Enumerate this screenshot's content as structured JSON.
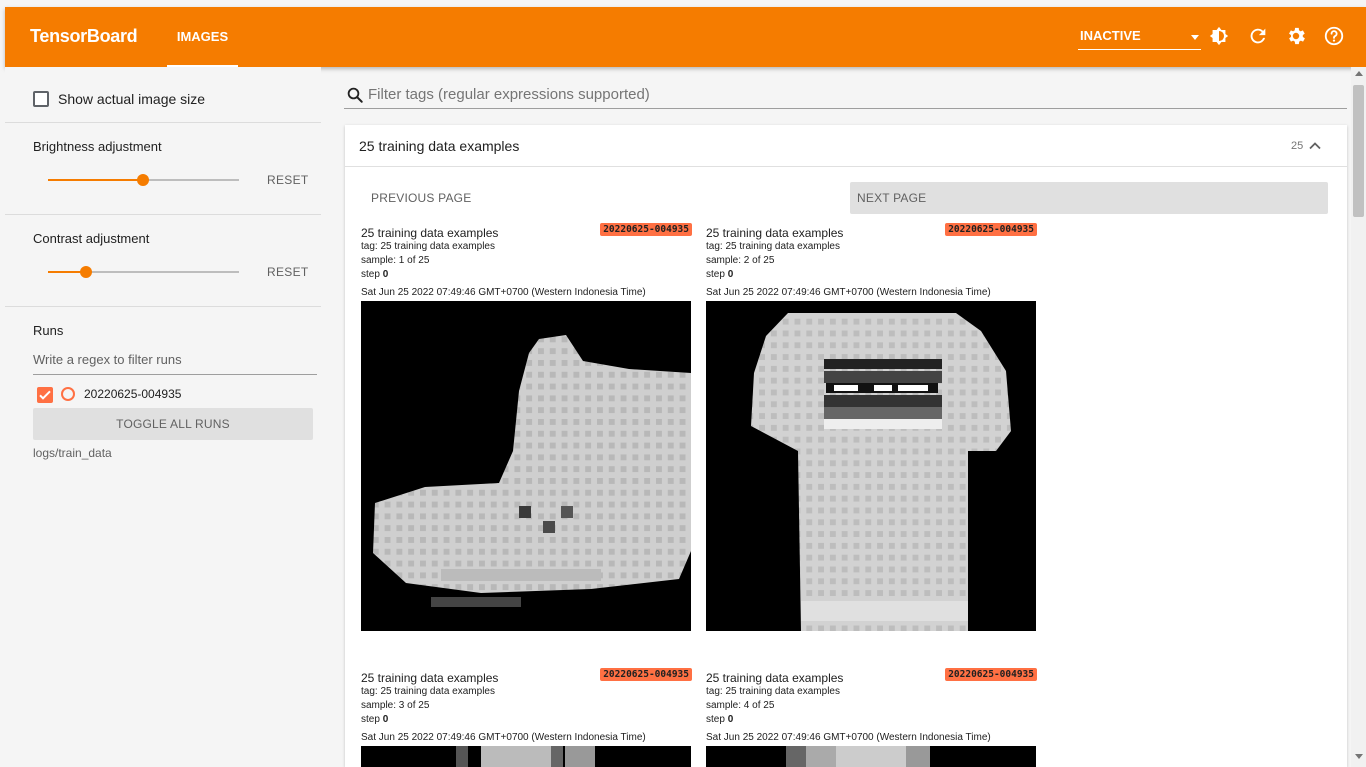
{
  "header": {
    "brand": "TensorBoard",
    "tab_images": "IMAGES",
    "inactive_label": "INACTIVE",
    "accent_color": "#f57c00",
    "icons": [
      "brightness-icon",
      "refresh-icon",
      "settings-icon",
      "help-icon"
    ]
  },
  "sidebar": {
    "show_actual_size_label": "Show actual image size",
    "show_actual_size_checked": false,
    "brightness": {
      "label": "Brightness adjustment",
      "value": 0.5,
      "reset_label": "RESET"
    },
    "contrast": {
      "label": "Contrast adjustment",
      "value": 0.2,
      "reset_label": "RESET"
    },
    "runs": {
      "title": "Runs",
      "filter_placeholder": "Write a regex to filter runs",
      "items": [
        {
          "name": "20220625-004935",
          "checked": true,
          "color": "#ff7043"
        }
      ],
      "toggle_all_label": "TOGGLE ALL RUNS",
      "logdir": "logs/train_data"
    }
  },
  "main": {
    "filter_placeholder": "Filter tags (regular expressions supported)",
    "card": {
      "title": "25 training data examples",
      "count": "25",
      "prev_page": "PREVIOUS PAGE",
      "next_page": "NEXT PAGE",
      "tiles": [
        {
          "title": "25 training data examples",
          "run": "20220625-004935",
          "tag": "tag: 25 training data examples",
          "sample": "sample: 1 of 25",
          "step_label": "step",
          "step_value": "0",
          "timestamp": "Sat Jun 25 2022 07:49:46 GMT+0700 (Western Indonesia Time)"
        },
        {
          "title": "25 training data examples",
          "run": "20220625-004935",
          "tag": "tag: 25 training data examples",
          "sample": "sample: 2 of 25",
          "step_label": "step",
          "step_value": "0",
          "timestamp": "Sat Jun 25 2022 07:49:46 GMT+0700 (Western Indonesia Time)"
        },
        {
          "title": "25 training data examples",
          "run": "20220625-004935",
          "tag": "tag: 25 training data examples",
          "sample": "sample: 3 of 25",
          "step_label": "step",
          "step_value": "0",
          "timestamp": "Sat Jun 25 2022 07:49:46 GMT+0700 (Western Indonesia Time)"
        },
        {
          "title": "25 training data examples",
          "run": "20220625-004935",
          "tag": "tag: 25 training data examples",
          "sample": "sample: 4 of 25",
          "step_label": "step",
          "step_value": "0",
          "timestamp": "Sat Jun 25 2022 07:49:46 GMT+0700 (Western Indonesia Time)"
        }
      ]
    }
  }
}
